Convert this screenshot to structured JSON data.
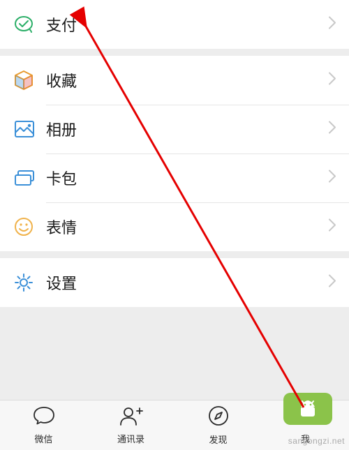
{
  "sections": [
    {
      "items": [
        {
          "id": "pay",
          "label": "支付",
          "icon": "pay-icon",
          "color": "#2aae67"
        }
      ]
    },
    {
      "items": [
        {
          "id": "favorites",
          "label": "收藏",
          "icon": "cube-icon",
          "color": "#f0b24a"
        },
        {
          "id": "album",
          "label": "相册",
          "icon": "image-icon",
          "color": "#3a8fd8"
        },
        {
          "id": "cards",
          "label": "卡包",
          "icon": "card-icon",
          "color": "#3a8fd8"
        },
        {
          "id": "stickers",
          "label": "表情",
          "icon": "smile-icon",
          "color": "#f0b24a"
        }
      ]
    },
    {
      "items": [
        {
          "id": "settings",
          "label": "设置",
          "icon": "gear-icon",
          "color": "#3a8fd8"
        }
      ]
    }
  ],
  "tabs": [
    {
      "id": "chats",
      "label": "微信",
      "icon": "chat-bubble-icon"
    },
    {
      "id": "contacts",
      "label": "通讯录",
      "icon": "person-add-icon"
    },
    {
      "id": "discover",
      "label": "发现",
      "icon": "compass-icon"
    },
    {
      "id": "me",
      "label": "我",
      "icon": "person-icon"
    }
  ],
  "watermark": "sangongzi.net",
  "annotation": {
    "target": "pay",
    "color": "#e50000"
  }
}
